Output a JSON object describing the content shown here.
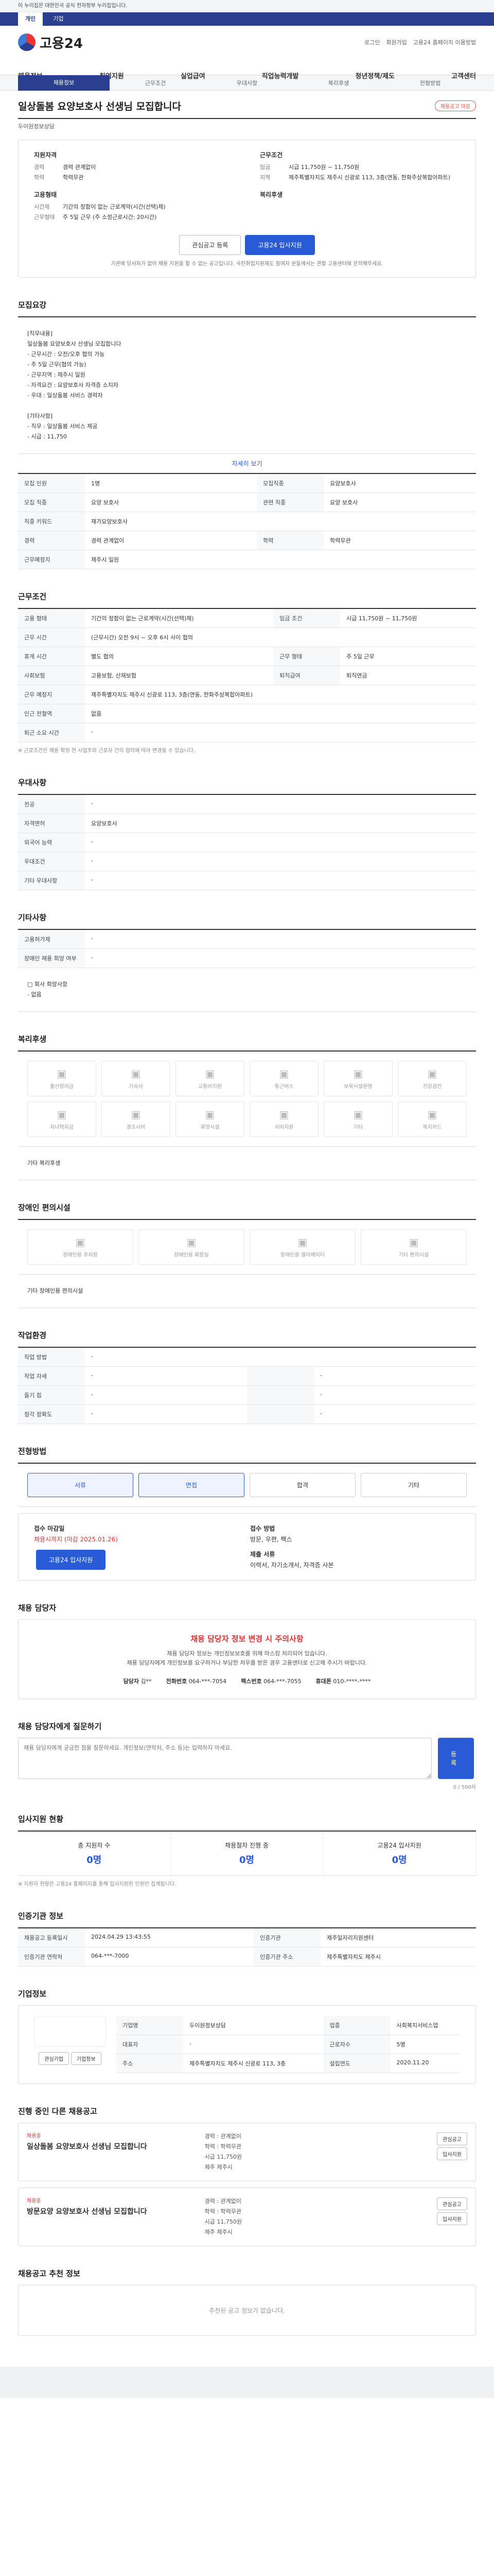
{
  "gov_notice": "이 누리집은 대한민국 공식 전자정부 누리집입니다.",
  "gov_tabs": [
    "개인",
    "기업"
  ],
  "brand": "고용24",
  "header_links": [
    "로그인",
    "회원가입",
    "고용24 홈페이지 이용방법"
  ],
  "gnb": [
    "채용정보",
    "취업지원",
    "실업급여",
    "직업능력개발",
    "청년정책/제도",
    "고객센터"
  ],
  "subtabs": [
    "채용정보",
    "근무조건",
    "우대사항",
    "복리후생",
    "전형방법"
  ],
  "title": "일상돌봄 요양보호사 선생님 모집합니다",
  "badge": "채용공고 마감",
  "company": "두이원정보상담",
  "summary": {
    "qual_h": "지원자격",
    "qual": [
      [
        "경력",
        "경력 관계없이"
      ],
      [
        "학력",
        "학력무관"
      ]
    ],
    "cond_h": "근무조건",
    "cond": [
      [
        "임금",
        "시급 11,750원 ~ 11,750원"
      ],
      [
        "지역",
        "제주특별자치도 제주시 신광로 113, 3층(연동, 한화주상복합아파트)"
      ]
    ],
    "form_h": "고용형태",
    "form": [
      [
        "시간제",
        "기간의 정함이 없는 근로계약(시간(선택)제)"
      ],
      [
        "근무형태",
        "주 5일 근무 (주 소정근로시간: 20시간)"
      ]
    ],
    "benefit_h": "복리후생",
    "benefit": []
  },
  "actions": [
    "관심공고 등록",
    "고용24 입사지원"
  ],
  "actions_note": "기관에 당사자가 없어 채용 지원을 할 수 없는 공고입니다. 국민취업지원제도 참여자 분들께서는 관할 고용센터에 문의해주세요.",
  "sec_recruit": "모집요강",
  "job_desc": "[직무내용]\n일상돌봄 요양보호사 선생님 모집합니다\n- 근무시간 : 오전/오후 협의 가능\n- 주 5일 근무(협의 가능)\n- 근무지역 : 제주시 일원\n- 자격요건 : 요양보호사 자격증 소지자\n- 우대 : 일상돌봄 서비스 경력자\n\n[기타사항]\n- 직무 : 일상돌봄 서비스 제공\n- 시급 : 11,750",
  "detail_more": "자세히 보기",
  "recruit_rows": [
    [
      "모집 인원",
      "1명",
      "모집직종",
      "요양보호사"
    ],
    [
      "모집 직종",
      "요양 보호사",
      "관련 직종",
      "요양 보호사"
    ],
    [
      "직종 키워드",
      "재가요양보호사",
      "",
      ""
    ],
    [
      "경력",
      "경력 관계없이",
      "학력",
      "학력무관"
    ],
    [
      "근무예정지",
      "제주시 일원",
      "",
      ""
    ]
  ],
  "sec_cond": "근무조건",
  "cond_rows": [
    [
      "고용 형태",
      "기간의 정함이 없는 근로계약(시간(선택)제)",
      "임금 조건",
      "시급 11,750원 ~ 11,750원"
    ],
    [
      "근무 시간",
      "(근무시간) 오전 9시 ~ 오후 6시 사이 협의",
      "",
      ""
    ],
    [
      "휴게 시간",
      "별도 협의",
      "근무 형태",
      "주 5일 근무"
    ],
    [
      "사회보험",
      "고용보험, 산재보험",
      "퇴직급여",
      "퇴직연금"
    ],
    [
      "근무 예정지",
      "제주특별자치도 제주시 신광로 113, 3층(연동, 한화주상복합아파트)",
      "",
      ""
    ],
    [
      "인근 전철역",
      "없음",
      "",
      ""
    ],
    [
      "퇴근 소요 시간",
      "-",
      "",
      ""
    ]
  ],
  "cond_note": "※ 근로조건은 채용 확정 전 사업주와 근로자 간의 협의에 따라 변경될 수 있습니다.",
  "sec_pref": "우대사항",
  "pref_rows": [
    [
      "전공",
      "-"
    ],
    [
      "자격면허",
      "요양보호사"
    ],
    [
      "외국어 능력",
      "-"
    ],
    [
      "우대조건",
      "-"
    ],
    [
      "기타 우대사항",
      "-"
    ]
  ],
  "sec_etc": "기타사항",
  "etc_rows": [
    [
      "고용허가제",
      "-"
    ],
    [
      "장애인 채용 희망 여부",
      "-"
    ]
  ],
  "etc_note": "□ 회사 희망사항\n- 없음",
  "sec_benefit": "복리후생",
  "benefits": [
    "출산장려금",
    "기숙사",
    "교통비지원",
    "통근버스",
    "보육시설운영",
    "건강검진",
    "자녀학자금",
    "경조사비",
    "휴양시설",
    "식비지원",
    "기타",
    "복지카드"
  ],
  "benefit_etc": "기타 복리후생",
  "sec_disab": "장애인 편의시설",
  "disab": [
    "장애인용 주차장",
    "장애인용 화장실",
    "장애인용 엘리베이터",
    "기타 편의시설"
  ],
  "disab_etc": "기타 장애인용 편의시설",
  "sec_env": "작업환경",
  "env_rows": [
    [
      "작업 방법",
      "-",
      "",
      ""
    ],
    [
      "작업 자세",
      "-",
      "",
      "-"
    ],
    [
      "들기 힘",
      "-",
      "",
      "-"
    ],
    [
      "청각 정확도",
      "-",
      "",
      "-"
    ]
  ],
  "sec_proc": "전형방법",
  "proc": [
    "서류",
    "면접",
    "합격",
    "기타"
  ],
  "apply": {
    "period_h": "접수 마감일",
    "period": "채용시까지 (마감 2025.01.26)",
    "how_h": "접수 방법",
    "how": "방문, 우편, 팩스",
    "docs_h": "제출 서류",
    "docs": "이력서, 자기소개서, 자격증 사본",
    "btn": "고용24 입사지원"
  },
  "sec_contact": "채용 담당자",
  "alert": {
    "title": "채용 담당자 정보 변경 시 주의사항",
    "body": "채용 담당자 정보는 개인정보보호를 위해 마스킹 처리되어 있습니다.\n채용 담당자에게 개인정보를 요구하거나 부당한 처우를 받은 경우 고용센터로 신고해 주시기 바랍니다."
  },
  "contact": {
    "name_h": "담당자",
    "name": "김**",
    "tel_h": "전화번호",
    "tel": "064-***-7054",
    "fax_h": "팩스번호",
    "fax": "064-***-7055",
    "mobile_h": "휴대폰",
    "mobile": "010-****-****"
  },
  "sec_inquiry": "채용 담당자에게 질문하기",
  "inquiry_ph": "채용 담당자에게 궁금한 점을 질문하세요. 개인정보(연락처, 주소 등)는 입력하지 마세요.",
  "inquiry_btn": "등록",
  "inquiry_count": "0 / 500자",
  "sec_status": "입사지원 현황",
  "status": [
    [
      "총 지원자 수",
      "0명"
    ],
    [
      "채용절차 진행 중",
      "0명"
    ],
    [
      "고용24 입사지원",
      "0명"
    ]
  ],
  "status_note": "※ 지원자 현황은 고용24 홈페이지를 통해 입사지원한 인원만 집계됩니다.",
  "sec_org": "인증기관 정보",
  "org_rows": [
    [
      "채용공고 등록일시",
      "2024.04.29 13:43:55",
      "인증기관",
      "제주일자리지원센터"
    ],
    [
      "인증기관 연락처",
      "064-***-7000",
      "인증기관 주소",
      "제주특별자치도 제주시"
    ]
  ],
  "sec_company": "기업정보",
  "company_info": {
    "name": "두이원정보상담",
    "rows": [
      [
        "기업명",
        "두이원정보상담",
        "업종",
        "사회복지서비스업"
      ],
      [
        "대표자",
        "-",
        "근로자수",
        "5명"
      ],
      [
        "주소",
        "제주특별자치도 제주시 신광로 113, 3층",
        "설립연도",
        "2020.11.20"
      ]
    ],
    "btns": [
      "관심기업",
      "기업정보"
    ]
  },
  "sec_similar": "진행 중인 다른 채용공고",
  "similar": [
    {
      "tag": "채용중",
      "title": "일상돌봄 요양보호사 선생님 모집합니다",
      "meta": [
        "경력 : 관계없이",
        "학력 : 학력무관",
        "시급 11,750원",
        "제주 제주시"
      ],
      "right": [
        "관심공고",
        "입사지원"
      ]
    },
    {
      "tag": "채용중",
      "title": "방문요양 요양보호사 선생님 모집합니다",
      "meta": [
        "경력 : 관계없이",
        "학력 : 학력무관",
        "시급 11,750원",
        "제주 제주시"
      ],
      "right": [
        "관심공고",
        "입사지원"
      ]
    }
  ],
  "sec_ai": "채용공고 추천 정보",
  "ai_empty": "추천된 공고 정보가 없습니다."
}
